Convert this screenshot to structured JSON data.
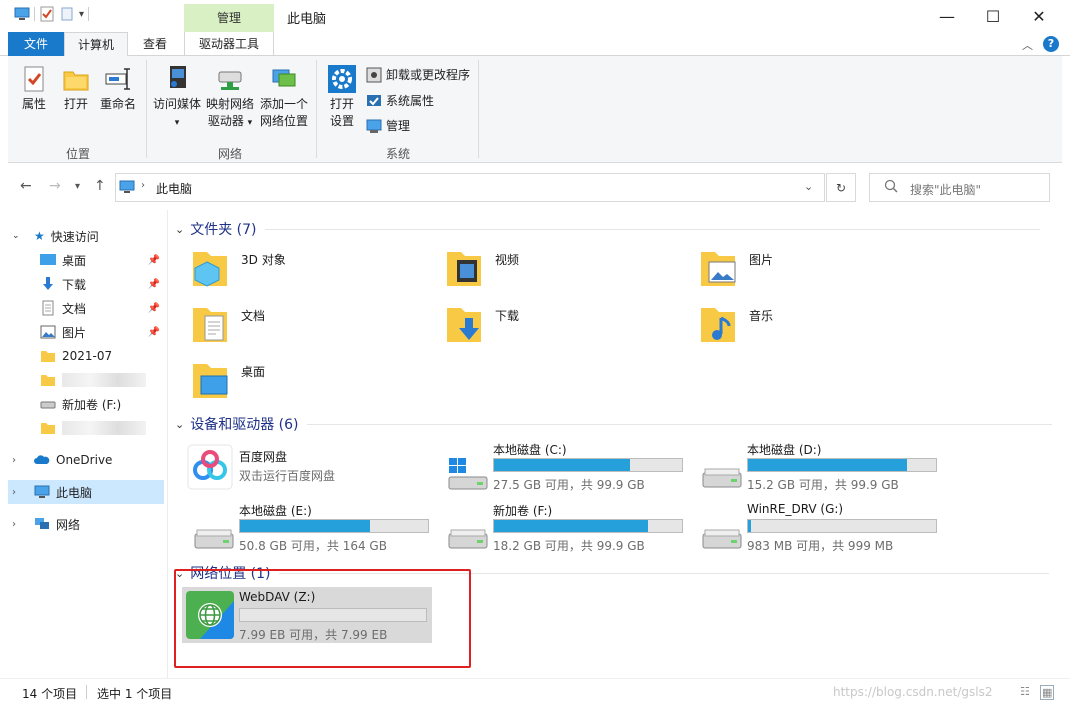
{
  "window": {
    "title": "此电脑",
    "context_group": "管理",
    "minimize": "—",
    "maximize": "☐",
    "close": "✕"
  },
  "tabs": {
    "file": "文件",
    "computer": "计算机",
    "view": "查看",
    "drive_tools": "驱动器工具"
  },
  "ribbon": {
    "location": {
      "label": "位置",
      "properties": "属性",
      "open": "打开",
      "rename": "重命名"
    },
    "network": {
      "label": "网络",
      "access_media": "访问媒体",
      "map_drive_1": "映射网络",
      "map_drive_2": "驱动器",
      "add_location_1": "添加一个",
      "add_location_2": "网络位置"
    },
    "system": {
      "label": "系统",
      "open_settings_1": "打开",
      "open_settings_2": "设置",
      "uninstall": "卸载或更改程序",
      "system_properties": "系统属性",
      "manage": "管理"
    }
  },
  "address": {
    "path": "此电脑",
    "search_placeholder": "搜索\"此电脑\""
  },
  "nav": {
    "quick_access": "快速访问",
    "desktop": "桌面",
    "downloads": "下载",
    "documents": "文档",
    "pictures": "图片",
    "folder_2021": "2021-07",
    "new_volume": "新加卷 (F:)",
    "onedrive": "OneDrive",
    "this_pc": "此电脑",
    "network": "网络"
  },
  "sections": {
    "folders": "文件夹 (7)",
    "devices": "设备和驱动器 (6)",
    "network_locations": "网络位置 (1)"
  },
  "folders": [
    {
      "name": "3D 对象",
      "icon": "3d-objects-folder-icon"
    },
    {
      "name": "视频",
      "icon": "videos-folder-icon"
    },
    {
      "name": "图片",
      "icon": "pictures-folder-icon"
    },
    {
      "name": "文档",
      "icon": "documents-folder-icon"
    },
    {
      "name": "下载",
      "icon": "downloads-folder-icon"
    },
    {
      "name": "音乐",
      "icon": "music-folder-icon"
    },
    {
      "name": "桌面",
      "icon": "desktop-folder-icon"
    }
  ],
  "baidu": {
    "name": "百度网盘",
    "desc": "双击运行百度网盘"
  },
  "drives": [
    {
      "name": "本地磁盘 (C:)",
      "capacity": "27.5 GB 可用，共 99.9 GB",
      "used_fraction": 0.725
    },
    {
      "name": "本地磁盘 (D:)",
      "capacity": "15.2 GB 可用，共 99.9 GB",
      "used_fraction": 0.848
    },
    {
      "name": "本地磁盘 (E:)",
      "capacity": "50.8 GB 可用，共 164 GB",
      "used_fraction": 0.69
    },
    {
      "name": "新加卷 (F:)",
      "capacity": "18.2 GB 可用，共 99.9 GB",
      "used_fraction": 0.818
    },
    {
      "name": "WinRE_DRV (G:)",
      "capacity": "983 MB 可用，共 999 MB",
      "used_fraction": 0.016
    }
  ],
  "webdav": {
    "name": "WebDAV (Z:)",
    "capacity": "7.99 EB 可用，共 7.99 EB",
    "used_fraction": 0.0
  },
  "status": {
    "count": "14 个项目",
    "selected": "选中 1 个项目"
  },
  "watermark": "https://blog.csdn.net/gsls2",
  "colors": {
    "accent": "#1979ca",
    "drive_bar": "#26a0da",
    "highlight_box": "#e02020",
    "context_tab": "#d9f0c4"
  }
}
